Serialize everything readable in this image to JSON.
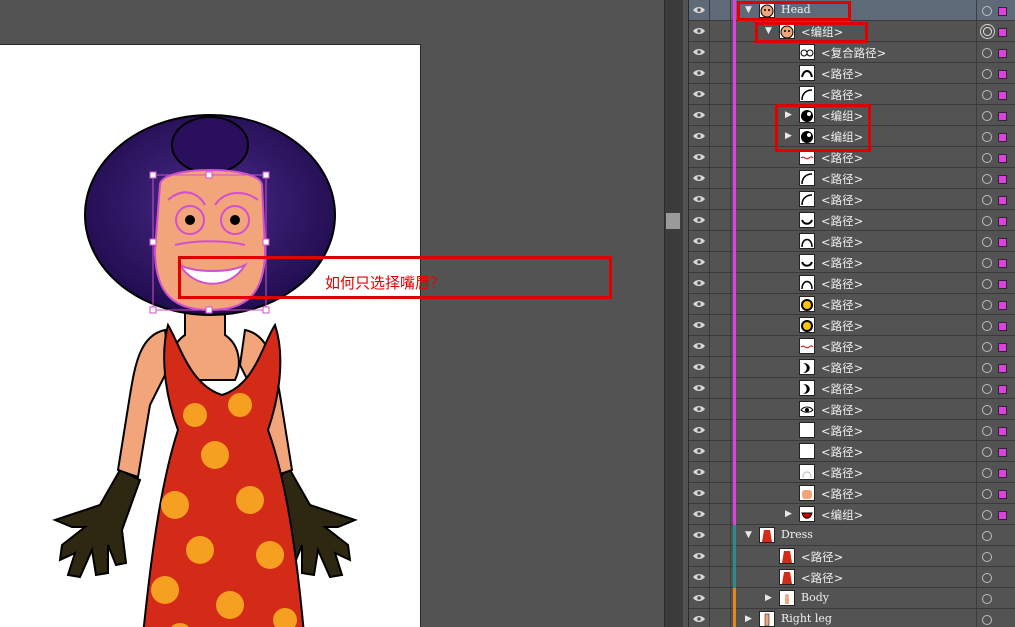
{
  "annotation": {
    "text": "如何只选择嘴唇？"
  },
  "colors": {
    "magenta": "#e040e0",
    "teal": "#2e8a8a",
    "orange": "#e08a1e",
    "selected_row": "#5f6a78"
  },
  "layers_panel": {
    "rows": [
      {
        "name": "Head",
        "indent": 0,
        "arrow": "down",
        "thumb": "face-icon",
        "bar": "magenta",
        "selected": true,
        "sq": true
      },
      {
        "name": "<编组>",
        "indent": 1,
        "arrow": "down",
        "thumb": "face-icon",
        "bar": "magenta",
        "target": "double",
        "sq": true
      },
      {
        "name": "<复合路径>",
        "indent": 2,
        "thumb": "glasses-icon",
        "bar": "magenta",
        "sq": true
      },
      {
        "name": "<路径>",
        "indent": 2,
        "thumb": "brow-icon",
        "bar": "magenta",
        "sq": true
      },
      {
        "name": "<路径>",
        "indent": 2,
        "thumb": "curve-icon",
        "bar": "magenta",
        "sq": true
      },
      {
        "name": "<编组>",
        "indent": 2,
        "arrow": "right",
        "thumb": "eye-ball-icon",
        "bar": "magenta",
        "sq": true
      },
      {
        "name": "<编组>",
        "indent": 2,
        "arrow": "right",
        "thumb": "eye-ball-icon",
        "bar": "magenta",
        "sq": true
      },
      {
        "name": "<路径>",
        "indent": 2,
        "thumb": "wave-icon",
        "bar": "magenta",
        "sq": true
      },
      {
        "name": "<路径>",
        "indent": 2,
        "thumb": "curve-icon",
        "bar": "magenta",
        "sq": true
      },
      {
        "name": "<路径>",
        "indent": 2,
        "thumb": "curve-icon",
        "bar": "magenta",
        "sq": true
      },
      {
        "name": "<路径>",
        "indent": 2,
        "thumb": "smile-icon",
        "bar": "magenta",
        "sq": true
      },
      {
        "name": "<路径>",
        "indent": 2,
        "thumb": "arch-icon",
        "bar": "magenta",
        "sq": true
      },
      {
        "name": "<路径>",
        "indent": 2,
        "thumb": "smile-icon",
        "bar": "magenta",
        "sq": true
      },
      {
        "name": "<路径>",
        "indent": 2,
        "thumb": "arch-icon",
        "bar": "magenta",
        "sq": true
      },
      {
        "name": "<路径>",
        "indent": 2,
        "thumb": "yellow-dot-icon",
        "bar": "magenta",
        "sq": true
      },
      {
        "name": "<路径>",
        "indent": 2,
        "thumb": "yellow-dot-icon",
        "bar": "magenta",
        "sq": true
      },
      {
        "name": "<路径>",
        "indent": 2,
        "thumb": "wave-icon",
        "bar": "magenta",
        "sq": true
      },
      {
        "name": "<路径>",
        "indent": 2,
        "thumb": "crescent-icon",
        "bar": "magenta",
        "sq": true
      },
      {
        "name": "<路径>",
        "indent": 2,
        "thumb": "crescent-icon",
        "bar": "magenta",
        "sq": true
      },
      {
        "name": "<路径>",
        "indent": 2,
        "thumb": "eye-shape-icon",
        "bar": "magenta",
        "sq": true
      },
      {
        "name": "<路径>",
        "indent": 2,
        "thumb": "blank-icon",
        "bar": "magenta",
        "sq": true
      },
      {
        "name": "<路径>",
        "indent": 2,
        "thumb": "blank-icon",
        "bar": "magenta",
        "sq": true
      },
      {
        "name": "<路径>",
        "indent": 2,
        "thumb": "outline-icon",
        "bar": "magenta",
        "sq": true
      },
      {
        "name": "<路径>",
        "indent": 2,
        "thumb": "skin-icon",
        "bar": "magenta",
        "sq": true
      },
      {
        "name": "<编组>",
        "indent": 2,
        "arrow": "right",
        "thumb": "mouth-icon",
        "bar": "magenta",
        "sq": true
      },
      {
        "name": "Dress",
        "indent": 0,
        "arrow": "down",
        "thumb": "dress-icon",
        "bar": "teal"
      },
      {
        "name": "<路径>",
        "indent": 1,
        "thumb": "dress-icon",
        "bar": "teal"
      },
      {
        "name": "<路径>",
        "indent": 1,
        "thumb": "dress-icon",
        "bar": "teal"
      },
      {
        "name": "Body",
        "indent": 1,
        "arrow": "right",
        "thumb": "body-icon",
        "bar": "orange"
      },
      {
        "name": "Right leg",
        "indent": 0,
        "arrow": "right",
        "thumb": "leg-icon",
        "bar": "orange"
      }
    ]
  }
}
